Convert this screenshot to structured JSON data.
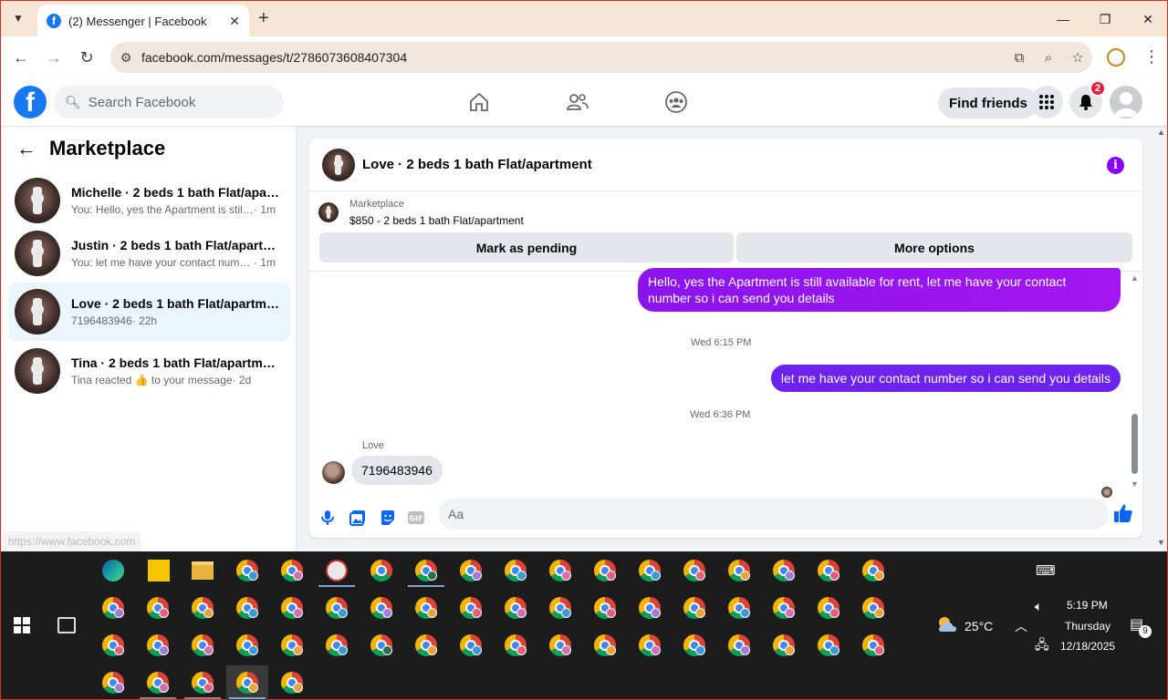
{
  "browser": {
    "tab_title": "(2) Messenger | Facebook",
    "url": "facebook.com/messages/t/2786073608407304",
    "status_url": "https://www.facebook.com"
  },
  "fb": {
    "search_placeholder": "Search Facebook",
    "find_friends": "Find friends",
    "notification_count": "2"
  },
  "sidebar": {
    "title": "Marketplace",
    "conversations": [
      {
        "name": "Michelle · 2 beds 1 bath Flat/apart...",
        "preview": "You: Hello, yes the Apartment is still a...",
        "time": "· 1m",
        "active": false
      },
      {
        "name": "Justin · 2 beds 1 bath Flat/apartment",
        "preview": "You: let me have your contact numbe...",
        "time": "· 1m",
        "active": false
      },
      {
        "name": "Love · 2 beds 1 bath Flat/apartment",
        "preview": "7196483946",
        "time": "· 22h",
        "active": true
      },
      {
        "name": "Tina · 2 beds 1 bath Flat/apartment",
        "preview": "Tina reacted 👍 to your message",
        "time": "· 2d",
        "active": false
      }
    ]
  },
  "chat": {
    "title": "Love · 2 beds 1 bath Flat/apartment",
    "marketplace_label": "Marketplace",
    "listing": "$850 - 2 beds 1 bath Flat/apartment",
    "mark_pending": "Mark as pending",
    "more_options": "More options",
    "messages": {
      "out1": "Hello, yes the Apartment is still available for rent, let me have your contact number so i can send you details",
      "ts1": "Wed 6:15 PM",
      "out2": "let me have your contact number so i can send you details",
      "ts2": "Wed 6:36 PM",
      "in_sender": "Love",
      "in1": "7196483946"
    },
    "composer_placeholder": "Aa",
    "gif_label": "GIF"
  },
  "taskbar": {
    "weather": "25°C",
    "time": "5:19 PM",
    "day": "Thursday",
    "date": "12/18/2025",
    "notif_count": "9"
  },
  "colors": {
    "fb_blue": "#1877f2",
    "messenger_purple": "#7c16f2",
    "accent_info": "#8a00ff"
  }
}
